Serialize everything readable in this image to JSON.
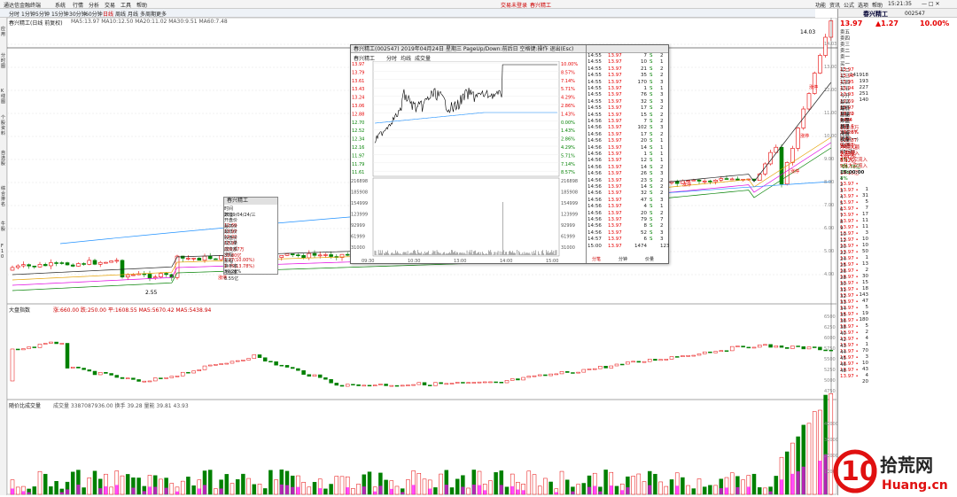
{
  "menubar": {
    "items": [
      "系统",
      "行情",
      "分析",
      "交易",
      "工具",
      "帮助"
    ],
    "center_items": [
      "交易未登录",
      "春兴精工"
    ],
    "right_items": [
      "功能",
      "资讯",
      "公式",
      "选项",
      "帮助"
    ],
    "clock": "15:21:35"
  },
  "period": {
    "items": [
      "分时",
      "1分钟",
      "5分钟",
      "15分钟",
      "30分钟",
      "60分钟",
      "日线",
      "周线",
      "月线",
      "多周期",
      "更多"
    ]
  },
  "sidetabs": [
    "应用",
    "分时图",
    "K线图",
    "个股资料",
    "自选股",
    "综合排名",
    "牛股",
    "F10"
  ],
  "main": {
    "title": "春兴精工(日线 前复权)",
    "ma_line": "MA5:13.97 MA10:12.50 MA20:11.02 MA30:9.51 MA60:7.48",
    "price_levels": [
      "14.03",
      "13.00",
      "12.00",
      "11.00",
      "10.00",
      "9.00",
      "8.00",
      "7.00",
      "6.00",
      "5.00",
      "4.00"
    ],
    "low_label": "2.55",
    "high_label": "14.03",
    "mark_zt": "涨停"
  },
  "index": {
    "title": "大盘指数",
    "values": "涨:660.00 跌:250.00 平:1608.55 MA5:5670.42 MA5:5438.94",
    "levels": [
      "6500",
      "6250",
      "6000",
      "5750",
      "5500",
      "5250",
      "5000",
      "4750"
    ]
  },
  "volume": {
    "title": "随价比成交量",
    "values": "成交量 3387087936.00 换手 39.28 量能 39.81 43.93",
    "levels": [
      "40000",
      "30000",
      "20000",
      "10000"
    ]
  },
  "popup": {
    "title": "春兴精工(002547)  2019年04月24日 星期三  PageUp/Down:前后日  空格键:操作  退出(Esc)",
    "sub_tabs": [
      "分时",
      "均线",
      "成交量"
    ],
    "price_left": [
      "13.97",
      "13.79",
      "13.61",
      "13.43",
      "13.24",
      "13.06",
      "12.88",
      "12.70",
      "12.52",
      "12.34",
      "12.16",
      "11.97",
      "11.79",
      "11.61"
    ],
    "pct_right": [
      "10.00%",
      "8.57%",
      "7.14%",
      "5.71%",
      "4.29%",
      "2.86%",
      "1.43%",
      "0.00%",
      "1.43%",
      "2.86%",
      "4.29%",
      "5.71%",
      "7.14%",
      "8.57%"
    ],
    "vol_left": [
      "216898",
      "185908",
      "154999",
      "123999",
      "92999",
      "61999",
      "31000"
    ],
    "time_labels": [
      "09:30",
      "10:30",
      "13:00",
      "14:00",
      "15:00"
    ],
    "ticks": [
      [
        "14:55",
        "13.97",
        "7",
        "S",
        "2"
      ],
      [
        "14:55",
        "13.97",
        "10",
        "S",
        "1"
      ],
      [
        "14:55",
        "13.97",
        "21",
        "S",
        "2"
      ],
      [
        "14:55",
        "13.97",
        "35",
        "S",
        "2"
      ],
      [
        "14:55",
        "13.97",
        "170",
        "S",
        "3"
      ],
      [
        "14:55",
        "13.97",
        "1",
        "S",
        "1"
      ],
      [
        "14:55",
        "13.97",
        "76",
        "S",
        "3"
      ],
      [
        "14:55",
        "13.97",
        "32",
        "S",
        "3"
      ],
      [
        "14:55",
        "13.97",
        "17",
        "S",
        "2"
      ],
      [
        "14:55",
        "13.97",
        "15",
        "S",
        "2"
      ],
      [
        "14:56",
        "13.97",
        "7",
        "S",
        "2"
      ],
      [
        "14:56",
        "13.97",
        "102",
        "S",
        "3"
      ],
      [
        "14:56",
        "13.97",
        "17",
        "S",
        "2"
      ],
      [
        "14:56",
        "13.97",
        "20",
        "S",
        "1"
      ],
      [
        "14:56",
        "13.97",
        "14",
        "S",
        "1"
      ],
      [
        "14:56",
        "13.97",
        "1",
        "S",
        "1"
      ],
      [
        "14:56",
        "13.97",
        "12",
        "S",
        "1"
      ],
      [
        "14:56",
        "13.97",
        "14",
        "S",
        "2"
      ],
      [
        "14:56",
        "13.97",
        "26",
        "S",
        "3"
      ],
      [
        "14:56",
        "13.97",
        "23",
        "S",
        "2"
      ],
      [
        "14:56",
        "13.97",
        "14",
        "S",
        "2"
      ],
      [
        "14:56",
        "13.97",
        "32",
        "S",
        "2"
      ],
      [
        "14:56",
        "13.97",
        "47",
        "S",
        "3"
      ],
      [
        "14:56",
        "13.97",
        "4",
        "S",
        "1"
      ],
      [
        "14:56",
        "13.97",
        "20",
        "S",
        "2"
      ],
      [
        "14:56",
        "13.97",
        "79",
        "S",
        "7"
      ],
      [
        "14:56",
        "13.97",
        "8",
        "S",
        "2"
      ],
      [
        "14:56",
        "13.97",
        "52",
        "S",
        "3"
      ],
      [
        "14:57",
        "13.97",
        "6",
        "S",
        "3"
      ],
      [
        "15:00",
        "13.97",
        "1474",
        "",
        "123"
      ]
    ],
    "tick_footer": [
      "分笔",
      "分钟",
      "价量"
    ]
  },
  "infobox": {
    "title": "春兴精工",
    "rows": [
      [
        "时间",
        "2019/04/24/三"
      ],
      [
        "数值",
        ""
      ],
      [
        "开盘价",
        "12.69"
      ],
      [
        "最高价",
        "13.97"
      ],
      [
        "最低价",
        "12.22"
      ],
      [
        "收盘价",
        "13.97"
      ],
      [
        "成交量",
        "256.67万"
      ],
      [
        "成交额",
        "33.80亿"
      ],
      [
        "涨幅",
        "1.27(10.00%)"
      ],
      [
        "振幅",
        "1.75(13.78%)"
      ],
      [
        "换手率",
        "39.28%"
      ],
      [
        "市盈率",
        "6.55亿"
      ]
    ]
  },
  "rightpanel": {
    "name": "春兴精工",
    "code": "002547",
    "price": "13.97",
    "change": "▲1.27",
    "pct": "10.00%",
    "asks": [
      [
        "卖五",
        "",
        ""
      ],
      [
        "卖四",
        "",
        ""
      ],
      [
        "卖三",
        "",
        ""
      ],
      [
        "卖二",
        "",
        ""
      ],
      [
        "卖一",
        "",
        ""
      ]
    ],
    "bids": [
      [
        "买一",
        "13.97",
        "141918"
      ],
      [
        "买二",
        "13.96",
        "193"
      ],
      [
        "买三",
        "13.95",
        "227"
      ],
      [
        "买四",
        "13.94",
        "251"
      ],
      [
        "买五",
        "13.93",
        "140"
      ]
    ],
    "stats": [
      [
        "今开",
        "12.69",
        "均价",
        "13.20"
      ],
      [
        "最高",
        "13.97",
        "量比",
        "1.89"
      ],
      [
        "最低",
        "12.22",
        "市盈",
        "157.6"
      ],
      [
        "总量",
        "1474",
        "总量",
        "256.67"
      ],
      [
        "外盘",
        "132.8万",
        "内盘",
        "123.87"
      ],
      [
        "换手",
        "39.28%",
        "股本",
        "11.3亿"
      ],
      [
        "净资",
        "2.42",
        "流通",
        "6.55亿"
      ],
      [
        "收益(一)",
        "0.035",
        "PE(动)",
        "394.0"
      ]
    ],
    "flows": [
      [
        "净流入额",
        "2.83亿",
        "8%"
      ],
      [
        "大宗流入",
        "3.12亿",
        "9%"
      ],
      [
        "5日大宗流入",
        "-15.78亿",
        "-3%"
      ],
      [
        "5日大宗流入",
        "14.15亿",
        "4%"
      ]
    ],
    "ticks_header": "15:00:00",
    "tick_rows": [
      [
        "1",
        "13.97",
        "1"
      ],
      [
        "2",
        "13.97",
        "31"
      ],
      [
        "3",
        "13.97",
        "5"
      ],
      [
        "4",
        "13.97",
        "7"
      ],
      [
        "5",
        "13.97",
        "17"
      ],
      [
        "6",
        "13.97",
        "11"
      ],
      [
        "7",
        "13.97",
        "11"
      ],
      [
        "8",
        "13.97",
        "3"
      ],
      [
        "9",
        "13.97",
        "10"
      ],
      [
        "10",
        "13.97",
        "10"
      ],
      [
        "12",
        "13.97",
        "50"
      ],
      [
        "20",
        "13.97",
        "1"
      ],
      [
        "22",
        "13.97",
        "13"
      ],
      [
        "24",
        "13.97",
        "2"
      ],
      [
        "25",
        "13.97",
        "30"
      ],
      [
        "26",
        "13.97",
        "15"
      ],
      [
        "28",
        "13.97",
        "18"
      ],
      [
        "30",
        "13.97",
        "143"
      ],
      [
        "31",
        "13.97",
        "47"
      ],
      [
        "32",
        "13.97",
        "5"
      ],
      [
        "33",
        "13.97",
        "19"
      ],
      [
        "34",
        "13.97",
        "180"
      ],
      [
        "35",
        "13.97",
        "5"
      ],
      [
        "36",
        "13.97",
        "2"
      ],
      [
        "38",
        "13.97",
        "4"
      ],
      [
        "40",
        "13.97",
        "1"
      ],
      [
        "42",
        "13.97",
        "70"
      ],
      [
        "43",
        "13.97",
        "3"
      ],
      [
        "44",
        "13.97",
        "10"
      ],
      [
        "45",
        "13.97",
        "43"
      ],
      [
        "46",
        "13.97",
        "4"
      ],
      [
        "48",
        "13.97",
        "20"
      ]
    ]
  },
  "watermark": {
    "big": "拾荒网",
    "url": "Huang.cn",
    "logo": "10"
  },
  "colors": {
    "up": "#e60000",
    "down": "#008000",
    "bg": "#ffffff",
    "accent": "#0050c8"
  }
}
